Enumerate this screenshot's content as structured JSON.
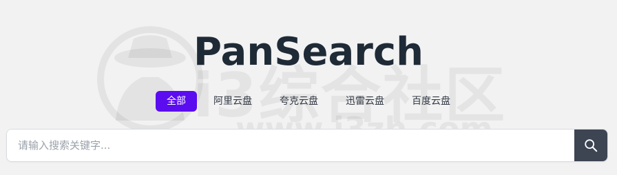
{
  "header": {
    "title": "PanSearch"
  },
  "tabs": [
    {
      "label": "全部",
      "active": true
    },
    {
      "label": "阿里云盘",
      "active": false
    },
    {
      "label": "夸克云盘",
      "active": false
    },
    {
      "label": "迅雷云盘",
      "active": false
    },
    {
      "label": "百度云盘",
      "active": false
    }
  ],
  "search": {
    "placeholder": "请输入搜索关键字...",
    "value": ""
  },
  "watermark": {
    "text_cn": "i3综合社区",
    "text_url": "www.i3zh.com"
  },
  "colors": {
    "accent": "#5b0df0",
    "search_button": "#3d4452",
    "title": "#1f2a37",
    "background": "#f2f2f2"
  },
  "icons": {
    "search_button": "search-icon",
    "watermark_logo": "hat-avatar-logo"
  }
}
